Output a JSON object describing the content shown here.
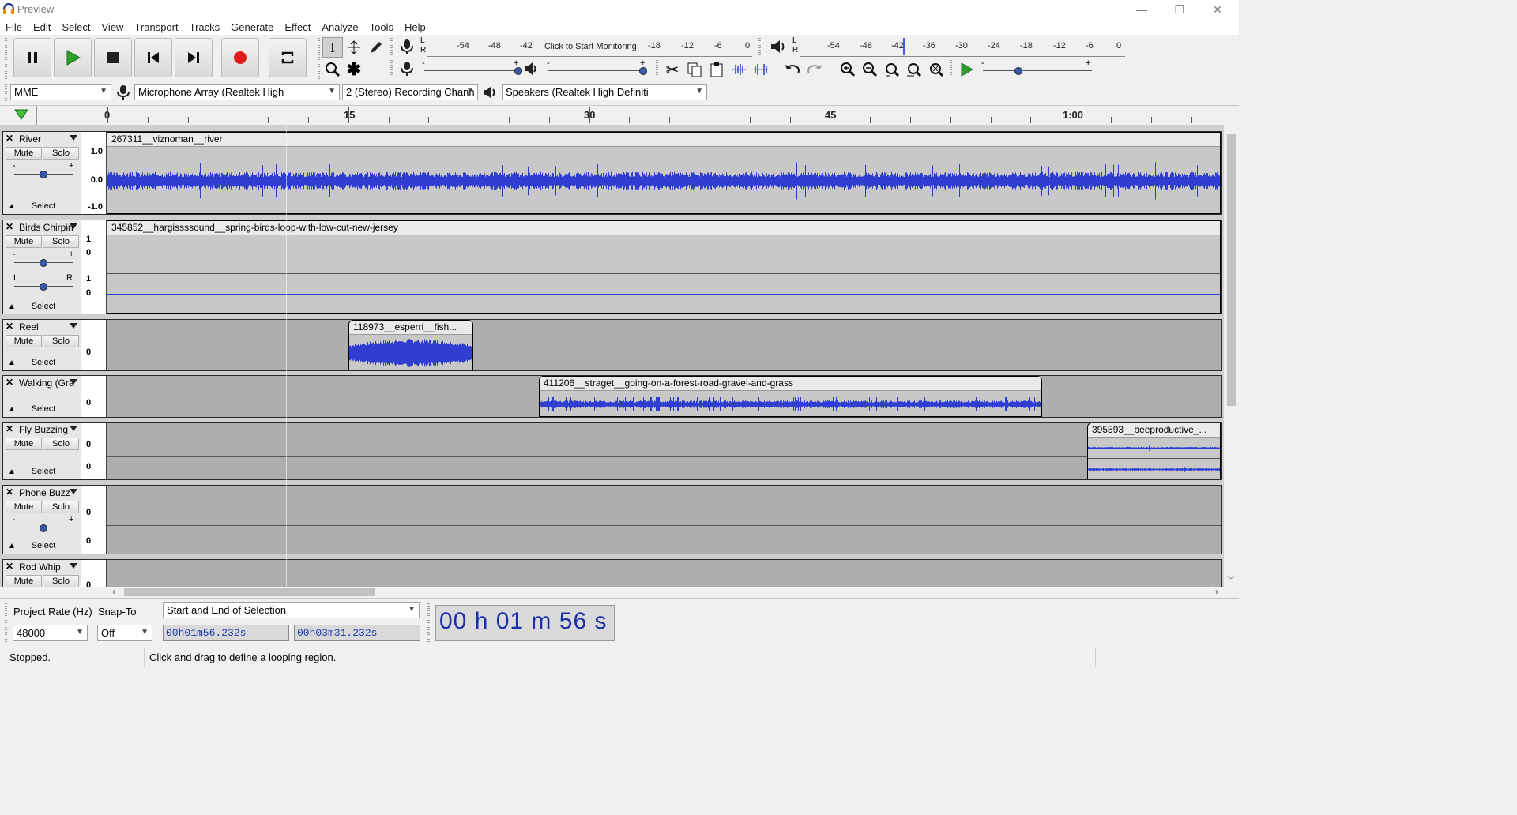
{
  "window": {
    "title": "Preview",
    "min_glyph": "—",
    "max_glyph": "❐",
    "close_glyph": "✕"
  },
  "menu": [
    "File",
    "Edit",
    "Select",
    "View",
    "Transport",
    "Tracks",
    "Generate",
    "Effect",
    "Analyze",
    "Tools",
    "Help"
  ],
  "meters": {
    "record_scale": [
      "-54",
      "-48",
      "-42",
      "Click to Start Monitoring",
      "-18",
      "-12",
      "-6",
      "0"
    ],
    "play_scale": [
      "-54",
      "-48",
      "-42",
      "-36",
      "-30",
      "-24",
      "-18",
      "-12",
      "-6",
      "0"
    ],
    "lr_left": "L",
    "lr_right": "R",
    "record_min": "-",
    "record_max": "+",
    "play_min": "-",
    "play_max": "+",
    "speed_min": "-",
    "speed_max": "+"
  },
  "device": {
    "host": "MME",
    "input": "Microphone Array (Realtek High",
    "channels": "2 (Stereo) Recording Chann",
    "output": "Speakers (Realtek High Definiti"
  },
  "ruler": [
    "0",
    "15",
    "30",
    "45",
    "1:00"
  ],
  "tracks": [
    {
      "name": "River",
      "clip": "267311__viznoman__river",
      "mute": "Mute",
      "solo": "Solo",
      "select": "Select",
      "scale": [
        "1.0",
        "0.0",
        "-1.0"
      ],
      "gain_min": "-",
      "gain_max": "+"
    },
    {
      "name": "Birds Chirpin",
      "clip": "345852__hargissssound__spring-birds-loop-with-low-cut-new-jersey",
      "mute": "Mute",
      "solo": "Solo",
      "select": "Select",
      "scale": [
        "1",
        "0",
        "1",
        "0"
      ],
      "gain_min": "-",
      "gain_max": "+",
      "pan_left": "L",
      "pan_right": "R"
    },
    {
      "name": "Reel",
      "clip": "118973__esperri__fish...",
      "mute": "Mute",
      "solo": "Solo",
      "select": "Select",
      "scale": [
        "0"
      ]
    },
    {
      "name": "Walking (Gra",
      "clip": "411206__straget__going-on-a-forest-road-gravel-and-grass",
      "select": "Select",
      "scale": [
        "0"
      ]
    },
    {
      "name": "Fly Buzzing",
      "clip": "395593__beeproductive_...",
      "mute": "Mute",
      "solo": "Solo",
      "select": "Select",
      "scale": [
        "0",
        "0"
      ]
    },
    {
      "name": "Phone Buzz",
      "mute": "Mute",
      "solo": "Solo",
      "select": "Select",
      "scale": [
        "0",
        "0"
      ],
      "gain_min": "-",
      "gain_max": "+"
    },
    {
      "name": "Rod Whip",
      "mute": "Mute",
      "solo": "Solo",
      "scale": [
        "0"
      ]
    }
  ],
  "selection": {
    "rate_label": "Project Rate (Hz)",
    "snap_label": "Snap-To",
    "mode": "Start and End of Selection",
    "rate": "48000",
    "snap": "Off",
    "start": "00h01m56.232s",
    "end": "00h03m31.232s",
    "audio_position": "00 h 01 m 56 s"
  },
  "status": {
    "state": "Stopped.",
    "hint": "Click and drag to define a looping region."
  },
  "colors": {
    "waveform": "#2f3ed0",
    "record": "#e01b1b",
    "play": "#2ca02c"
  }
}
